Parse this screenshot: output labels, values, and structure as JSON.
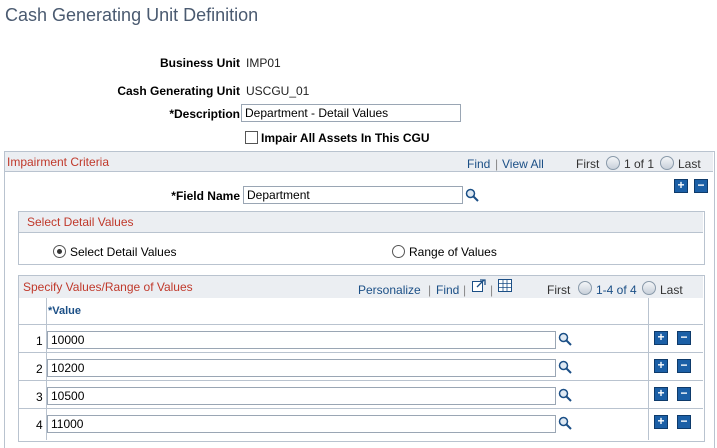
{
  "page": {
    "title": "Cash Generating Unit Definition"
  },
  "form": {
    "business_unit_label": "Business Unit",
    "business_unit_value": "IMP01",
    "cgu_label": "Cash Generating Unit",
    "cgu_value": "USCGU_01",
    "description_label": "*Description",
    "description_value": "Department - Detail Values",
    "impair_label": "Impair All Assets In This CGU",
    "impair_checked": false
  },
  "criteria": {
    "header": "Impairment Criteria",
    "find": "Find",
    "view_all": "View All",
    "first": "First",
    "range": "1 of 1",
    "last": "Last",
    "field_name_label": "*Field Name",
    "field_name_value": "Department"
  },
  "detail": {
    "header": "Select Detail Values",
    "option_detail": "Select Detail Values",
    "option_range": "Range of Values",
    "selected": "detail"
  },
  "values_grid": {
    "header": "Specify Values/Range of Values",
    "personalize": "Personalize",
    "find": "Find",
    "first": "First",
    "range": "1-4 of 4",
    "last": "Last",
    "column_value": "*Value",
    "rows": [
      {
        "num": "1",
        "value": "10000"
      },
      {
        "num": "2",
        "value": "10200"
      },
      {
        "num": "3",
        "value": "10500"
      },
      {
        "num": "4",
        "value": "11000"
      }
    ]
  },
  "colors": {
    "header_text": "#c0392b",
    "link": "#1b4f86",
    "header_bg": "#ebeef2"
  }
}
